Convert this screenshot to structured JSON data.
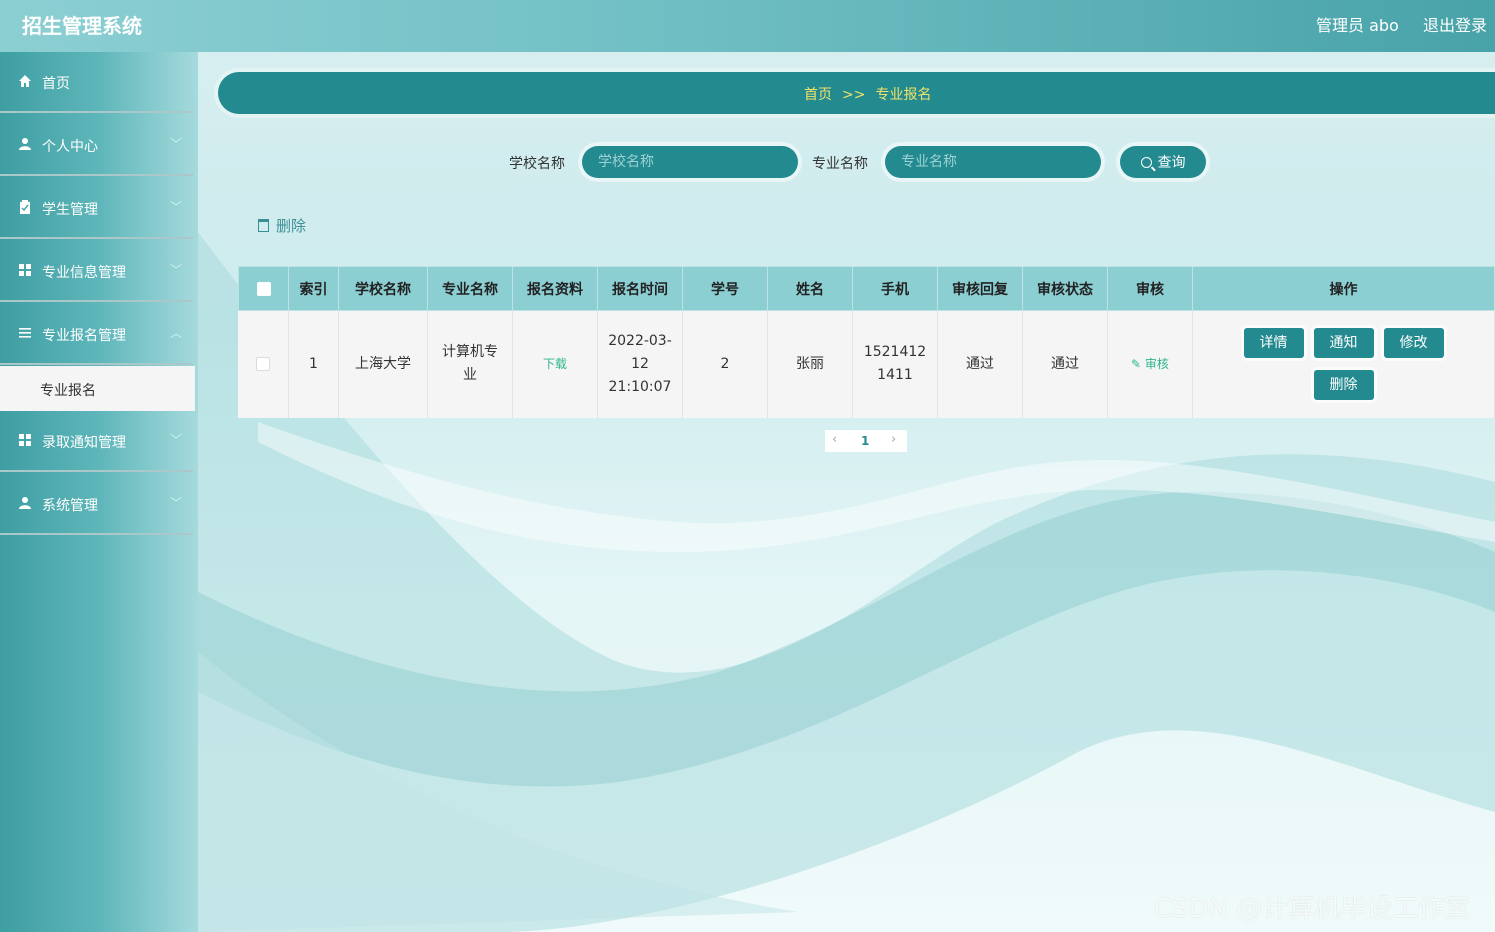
{
  "header": {
    "app_title": "招生管理系统",
    "user_label": "管理员 abo",
    "logout_label": "退出登录"
  },
  "sidebar": {
    "items": [
      {
        "label": "首页",
        "icon": "home-icon"
      },
      {
        "label": "个人中心",
        "icon": "user-icon"
      },
      {
        "label": "学生管理",
        "icon": "clipboard-icon"
      },
      {
        "label": "专业信息管理",
        "icon": "grid-icon"
      },
      {
        "label": "专业报名管理",
        "icon": "list-icon"
      },
      {
        "label": "录取通知管理",
        "icon": "grid-icon"
      },
      {
        "label": "系统管理",
        "icon": "user-icon"
      }
    ],
    "active_sub": "专业报名"
  },
  "breadcrumb": {
    "home": "首页",
    "sep": ">>",
    "current": "专业报名"
  },
  "search": {
    "school_label": "学校名称",
    "school_placeholder": "学校名称",
    "major_label": "专业名称",
    "major_placeholder": "专业名称",
    "query_label": "查询"
  },
  "toolbar": {
    "delete_label": "删除"
  },
  "table": {
    "columns": [
      "索引",
      "学校名称",
      "专业名称",
      "报名资料",
      "报名时间",
      "学号",
      "姓名",
      "手机",
      "审核回复",
      "审核状态",
      "审核",
      "操作"
    ],
    "rows": [
      {
        "index": "1",
        "school": "上海大学",
        "major": "计算机专业",
        "material": "下载",
        "time": "2022-03-12 21:10:07",
        "student_no": "2",
        "name": "张丽",
        "phone": "15214121411",
        "reply": "通过",
        "status": "通过",
        "review": "审核",
        "actions": [
          "详情",
          "通知",
          "修改",
          "删除"
        ]
      }
    ]
  },
  "pagination": {
    "current": "1"
  },
  "watermark": "CSDN @计算机毕设工作室",
  "colors": {
    "primary": "#238a90",
    "header_row": "#8ccfd3",
    "breadcrumb_text": "#f0e36a",
    "link_green": "#2fb58e"
  }
}
